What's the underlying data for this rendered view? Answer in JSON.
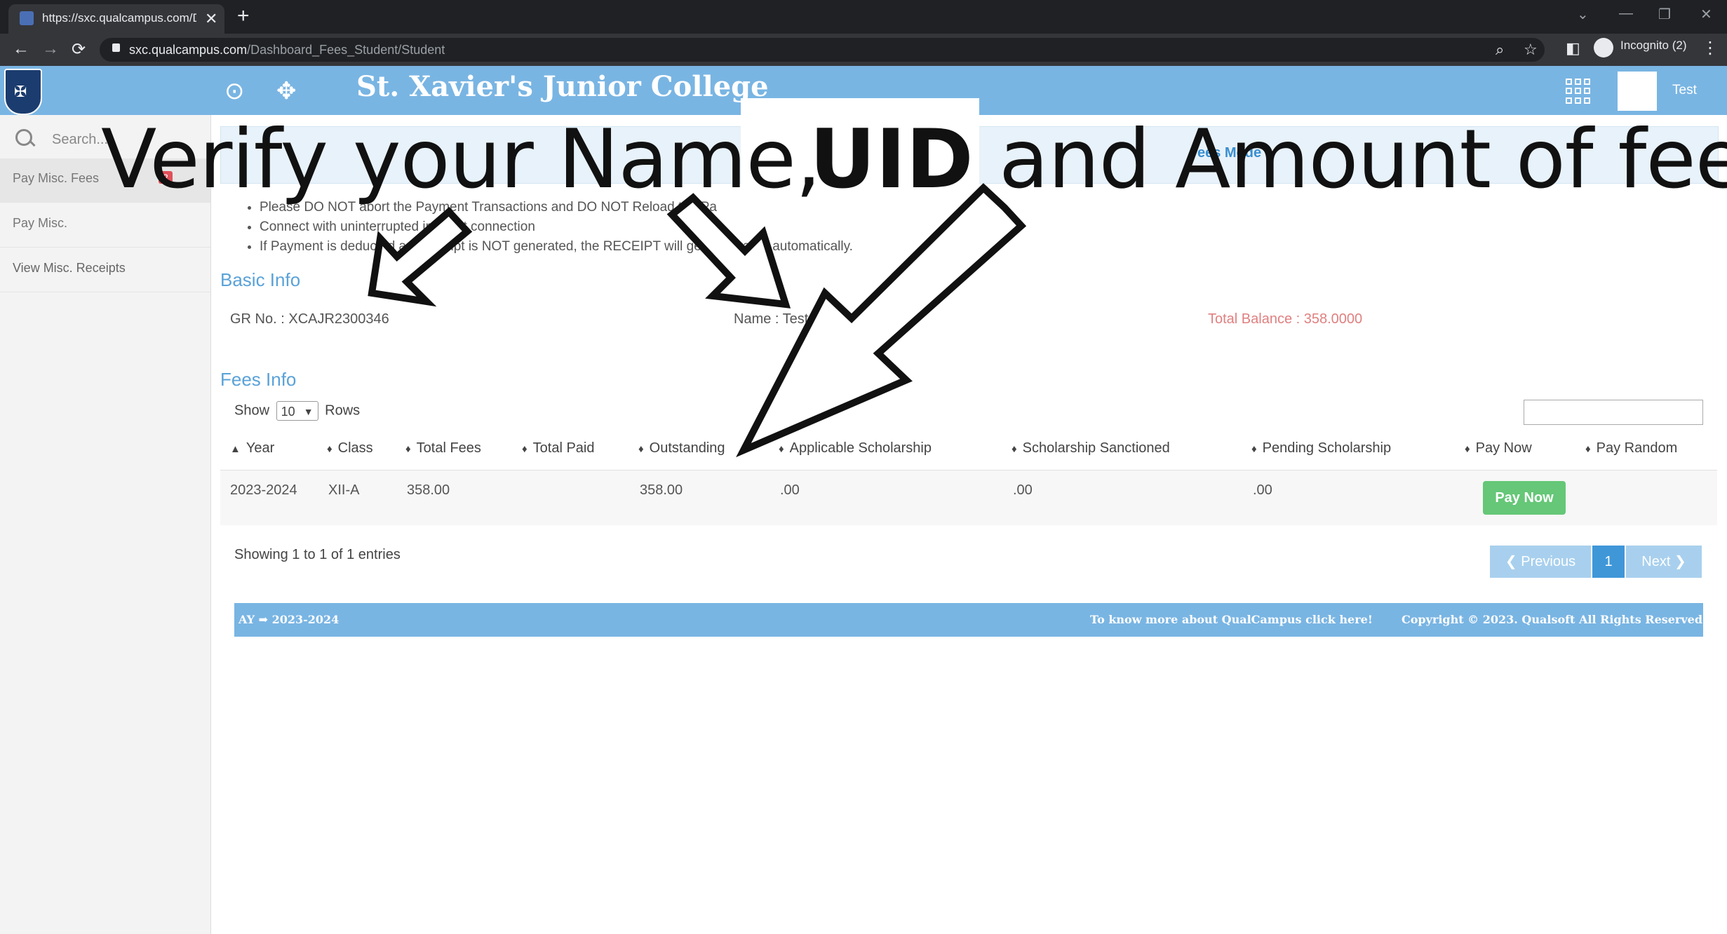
{
  "browser": {
    "tab_title": "https://sxc.qualcampus.com/Das",
    "new_tab": "+",
    "url_domain": "sxc.qualcampus.com",
    "url_path": "/Dashboard_Fees_Student/Student",
    "incognito_label": "Incognito (2)"
  },
  "header": {
    "college_name": "St. Xavier's Junior College",
    "user_name": "Test"
  },
  "sidebar": {
    "search_placeholder": "Search...",
    "badge": "2",
    "items": [
      {
        "label": "Pay Misc. Fees"
      },
      {
        "label": "Pay Misc."
      },
      {
        "label": "View Misc. Receipts"
      }
    ]
  },
  "overlay": {
    "part1": "Verify your Name,",
    "uid": "UID",
    "part2": "and Amount of fees"
  },
  "alert": {
    "title_fragment": "ees Mode"
  },
  "notes": [
    "Please DO NOT abort the Payment Transactions and DO NOT Reload the Pa",
    "Connect with uninterrupted internet connection",
    "If Payment is deducted and receipt is NOT generated, the RECEIPT will get generated automatically."
  ],
  "basic_info": {
    "heading": "Basic Info",
    "gr_no": "GR No. : XCAJR2300346",
    "name": "Name : Test Test 2023",
    "total_balance": "Total Balance : 358.0000"
  },
  "fees_info": {
    "heading": "Fees Info",
    "show_label": "Show",
    "rows_value": "10",
    "rows_label": "Rows",
    "columns": [
      "Year",
      "Class",
      "Total Fees",
      "Total Paid",
      "Outstanding",
      "Applicable Scholarship",
      "Scholarship Sanctioned",
      "Pending Scholarship",
      "Pay Now",
      "Pay Random"
    ],
    "rows": [
      {
        "year": "2023-2024",
        "class": "XII-A",
        "total_fees": "358.00",
        "total_paid": "",
        "outstanding": "358.00",
        "applicable": ".00",
        "sanctioned": ".00",
        "pending": ".00",
        "pay_now_label": "Pay Now"
      }
    ],
    "showing": "Showing 1 to 1 of 1 entries",
    "prev_label": "Previous",
    "page": "1",
    "next_label": "Next"
  },
  "footer": {
    "ay_label": "AY",
    "ay_value": "2023-2024",
    "link_text": "To know more about QualCampus click here!",
    "copyright": "Copyright © 2023. Qualsoft All Rights Reserved."
  },
  "colors": {
    "header_blue": "#79b5e3",
    "accent_text": "#5aa2d8",
    "pay_now_green": "#65c777",
    "balance_red": "#e08080"
  }
}
